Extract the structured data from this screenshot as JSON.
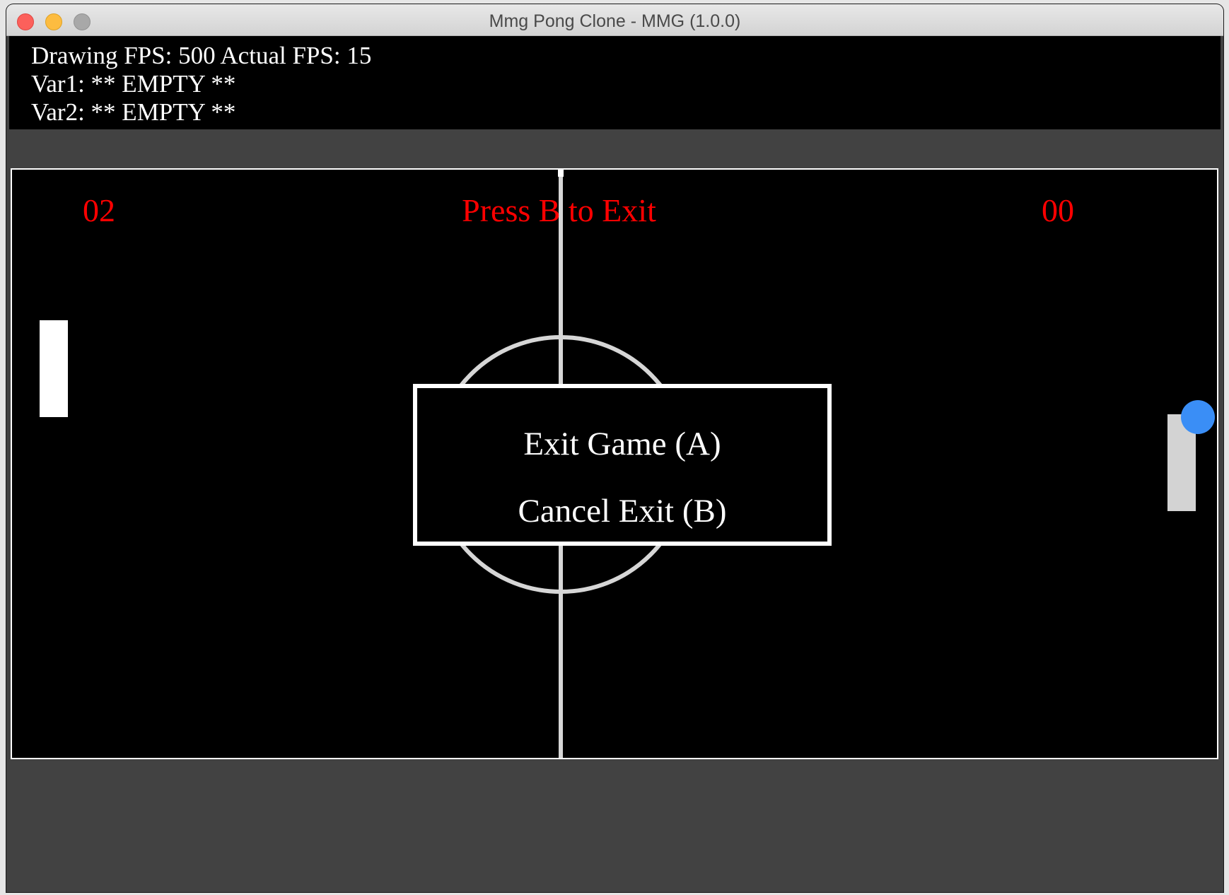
{
  "window": {
    "title": "Mmg Pong Clone - MMG (1.0.0)"
  },
  "debug": {
    "fps_line": "Drawing FPS: 500 Actual FPS: 15",
    "var1_line": "Var1: ** EMPTY **",
    "var2_line": "Var2: ** EMPTY **"
  },
  "game": {
    "left_score": "02",
    "right_score": "00",
    "hint": "Press B to Exit"
  },
  "exit_dialog": {
    "exit_option": "Exit Game (A)",
    "cancel_option": "Cancel Exit (B)"
  },
  "colors": {
    "score": "#ff0000",
    "left_paddle": "#ffffff",
    "right_paddle": "#d3d3d3",
    "ball": "#3a8ef6",
    "court_lines": "#d6d6d6"
  }
}
